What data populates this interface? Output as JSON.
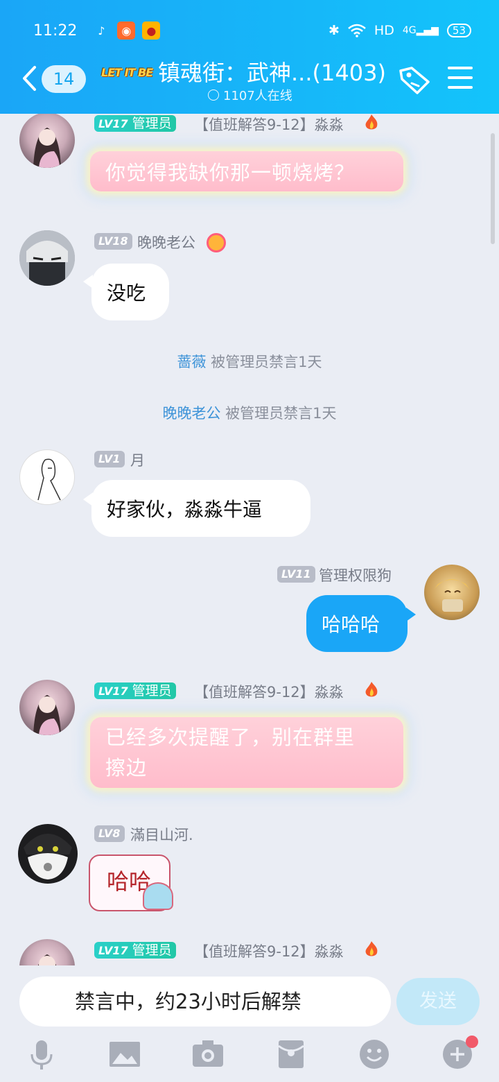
{
  "status_bar": {
    "time": "11:22",
    "network": "HD",
    "signal": "4G",
    "battery": "53"
  },
  "header": {
    "unread_count": "14",
    "logo_text": "LET IT BE",
    "title": "镇魂街：武神...(1403)",
    "online": "1107人在线"
  },
  "messages": [
    {
      "level": "LV17",
      "role": "管理员",
      "name": "【值班解答9-12】淼淼",
      "text": "你觉得我缺你那一顿烧烤？"
    },
    {
      "level": "LV18",
      "name": "晚晚老公",
      "text": "没吃"
    },
    {
      "level": "LV1",
      "name": "月",
      "text": "好家伙，淼淼牛逼"
    },
    {
      "level": "LV11",
      "name": "管理权限狗",
      "text": "哈哈哈"
    },
    {
      "level": "LV17",
      "role": "管理员",
      "name": "【值班解答9-12】淼淼",
      "text_line1": "已经多次提醒了，别在群里",
      "text_line2": "擦边"
    },
    {
      "level": "LV8",
      "name": "滿目山河.",
      "sticker_text": "哈哈"
    },
    {
      "level": "LV17",
      "role": "管理员",
      "name": "【值班解答9-12】淼淼"
    }
  ],
  "system": [
    {
      "who": "蔷薇",
      "text": "被管理员禁言1天"
    },
    {
      "who": "晚晚老公",
      "text": "被管理员禁言1天"
    }
  ],
  "input": {
    "text": "禁言中，约23小时后解禁",
    "send_label": "发送"
  },
  "colors": {
    "accent": "#1aa6f7",
    "admin_badge": "#22c7a6",
    "system_name": "#3d93d8"
  }
}
